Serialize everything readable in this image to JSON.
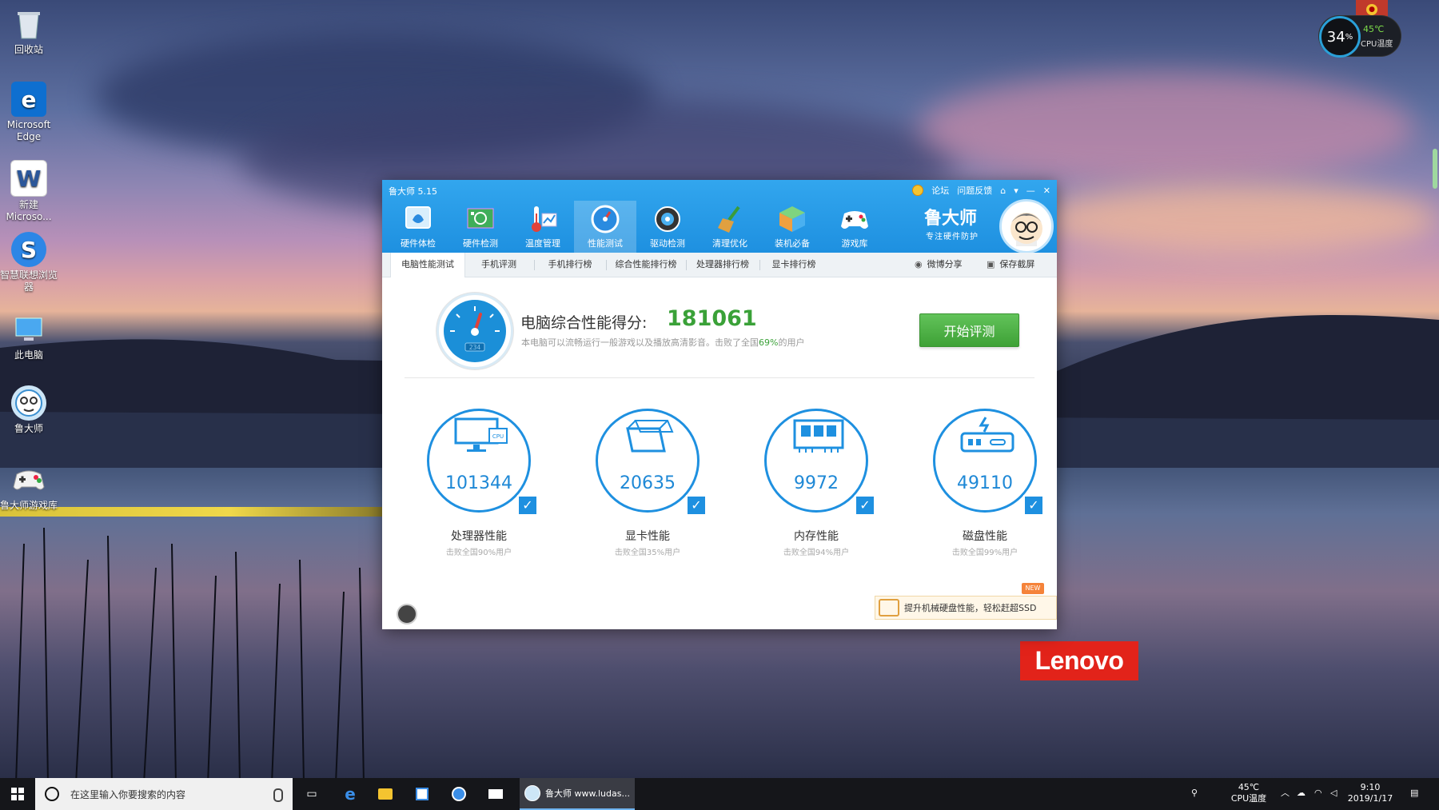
{
  "desktop": {
    "icons": [
      {
        "label": "回收站"
      },
      {
        "label": "Microsoft Edge"
      },
      {
        "label": "新建 Microso..."
      },
      {
        "label": "智慧联想浏览器"
      },
      {
        "label": "此电脑"
      },
      {
        "label": "鲁大师"
      },
      {
        "label": "鲁大师游戏库"
      }
    ],
    "lenovo_logo": "Lenovo",
    "cpu_widget": {
      "percent": "34",
      "percent_unit": "%",
      "temp": "45℃",
      "label": "CPU温度"
    }
  },
  "app": {
    "title": "鲁大师 5.15",
    "title_links": [
      "论坛",
      "问题反馈"
    ],
    "nav": [
      {
        "label": "硬件体检",
        "icon": "health-check-icon"
      },
      {
        "label": "硬件检测",
        "icon": "hardware-board-icon"
      },
      {
        "label": "温度管理",
        "icon": "thermometer-icon"
      },
      {
        "label": "性能测试",
        "icon": "speedometer-icon",
        "active": true
      },
      {
        "label": "驱动检测",
        "icon": "gear-driver-icon"
      },
      {
        "label": "清理优化",
        "icon": "broom-icon"
      },
      {
        "label": "装机必备",
        "icon": "cube-icon"
      },
      {
        "label": "游戏库",
        "icon": "gamepad-icon"
      }
    ],
    "brand": {
      "name": "鲁大师",
      "slogan": "专注硬件防护"
    },
    "tabs": [
      {
        "label": "电脑性能测试",
        "active": true
      },
      {
        "label": "手机评测"
      },
      {
        "label": "手机排行榜"
      },
      {
        "label": "综合性能排行榜"
      },
      {
        "label": "处理器排行榜"
      },
      {
        "label": "显卡排行榜"
      }
    ],
    "share_label": "微博分享",
    "screenshot_label": "保存截屏",
    "score": {
      "label": "电脑综合性能得分:",
      "value": "181061",
      "gauge_text": "234",
      "desc_before": "本电脑可以流畅运行一般游戏以及播放高清影音。击败了全国",
      "desc_percent": "69%",
      "desc_after": "的用户"
    },
    "start_button": "开始评测",
    "metrics": [
      {
        "value": "101344",
        "title": "处理器性能",
        "sub": "击败全国90%用户",
        "icon": "monitor-cpu-icon"
      },
      {
        "value": "20635",
        "title": "显卡性能",
        "sub": "击败全国35%用户",
        "icon": "graphics-cube-icon"
      },
      {
        "value": "9972",
        "title": "内存性能",
        "sub": "击败全国94%用户",
        "icon": "memory-chip-icon"
      },
      {
        "value": "49110",
        "title": "磁盘性能",
        "sub": "击败全国99%用户",
        "icon": "disk-drive-icon"
      }
    ],
    "promo": {
      "text": "提升机械硬盘性能，轻松赶超SSD",
      "badge": "NEW"
    }
  },
  "taskbar": {
    "search_placeholder": "在这里输入你要搜索的内容",
    "active_app": "鲁大师 www.ludas...",
    "tray_temp": "45℃",
    "tray_temp_label": "CPU温度",
    "time": "9:10",
    "date": "2019/1/17"
  },
  "colors": {
    "accent": "#1e90e0",
    "score_green": "#3aa138",
    "button_green": "#4cb043",
    "lenovo_red": "#e2231a"
  }
}
